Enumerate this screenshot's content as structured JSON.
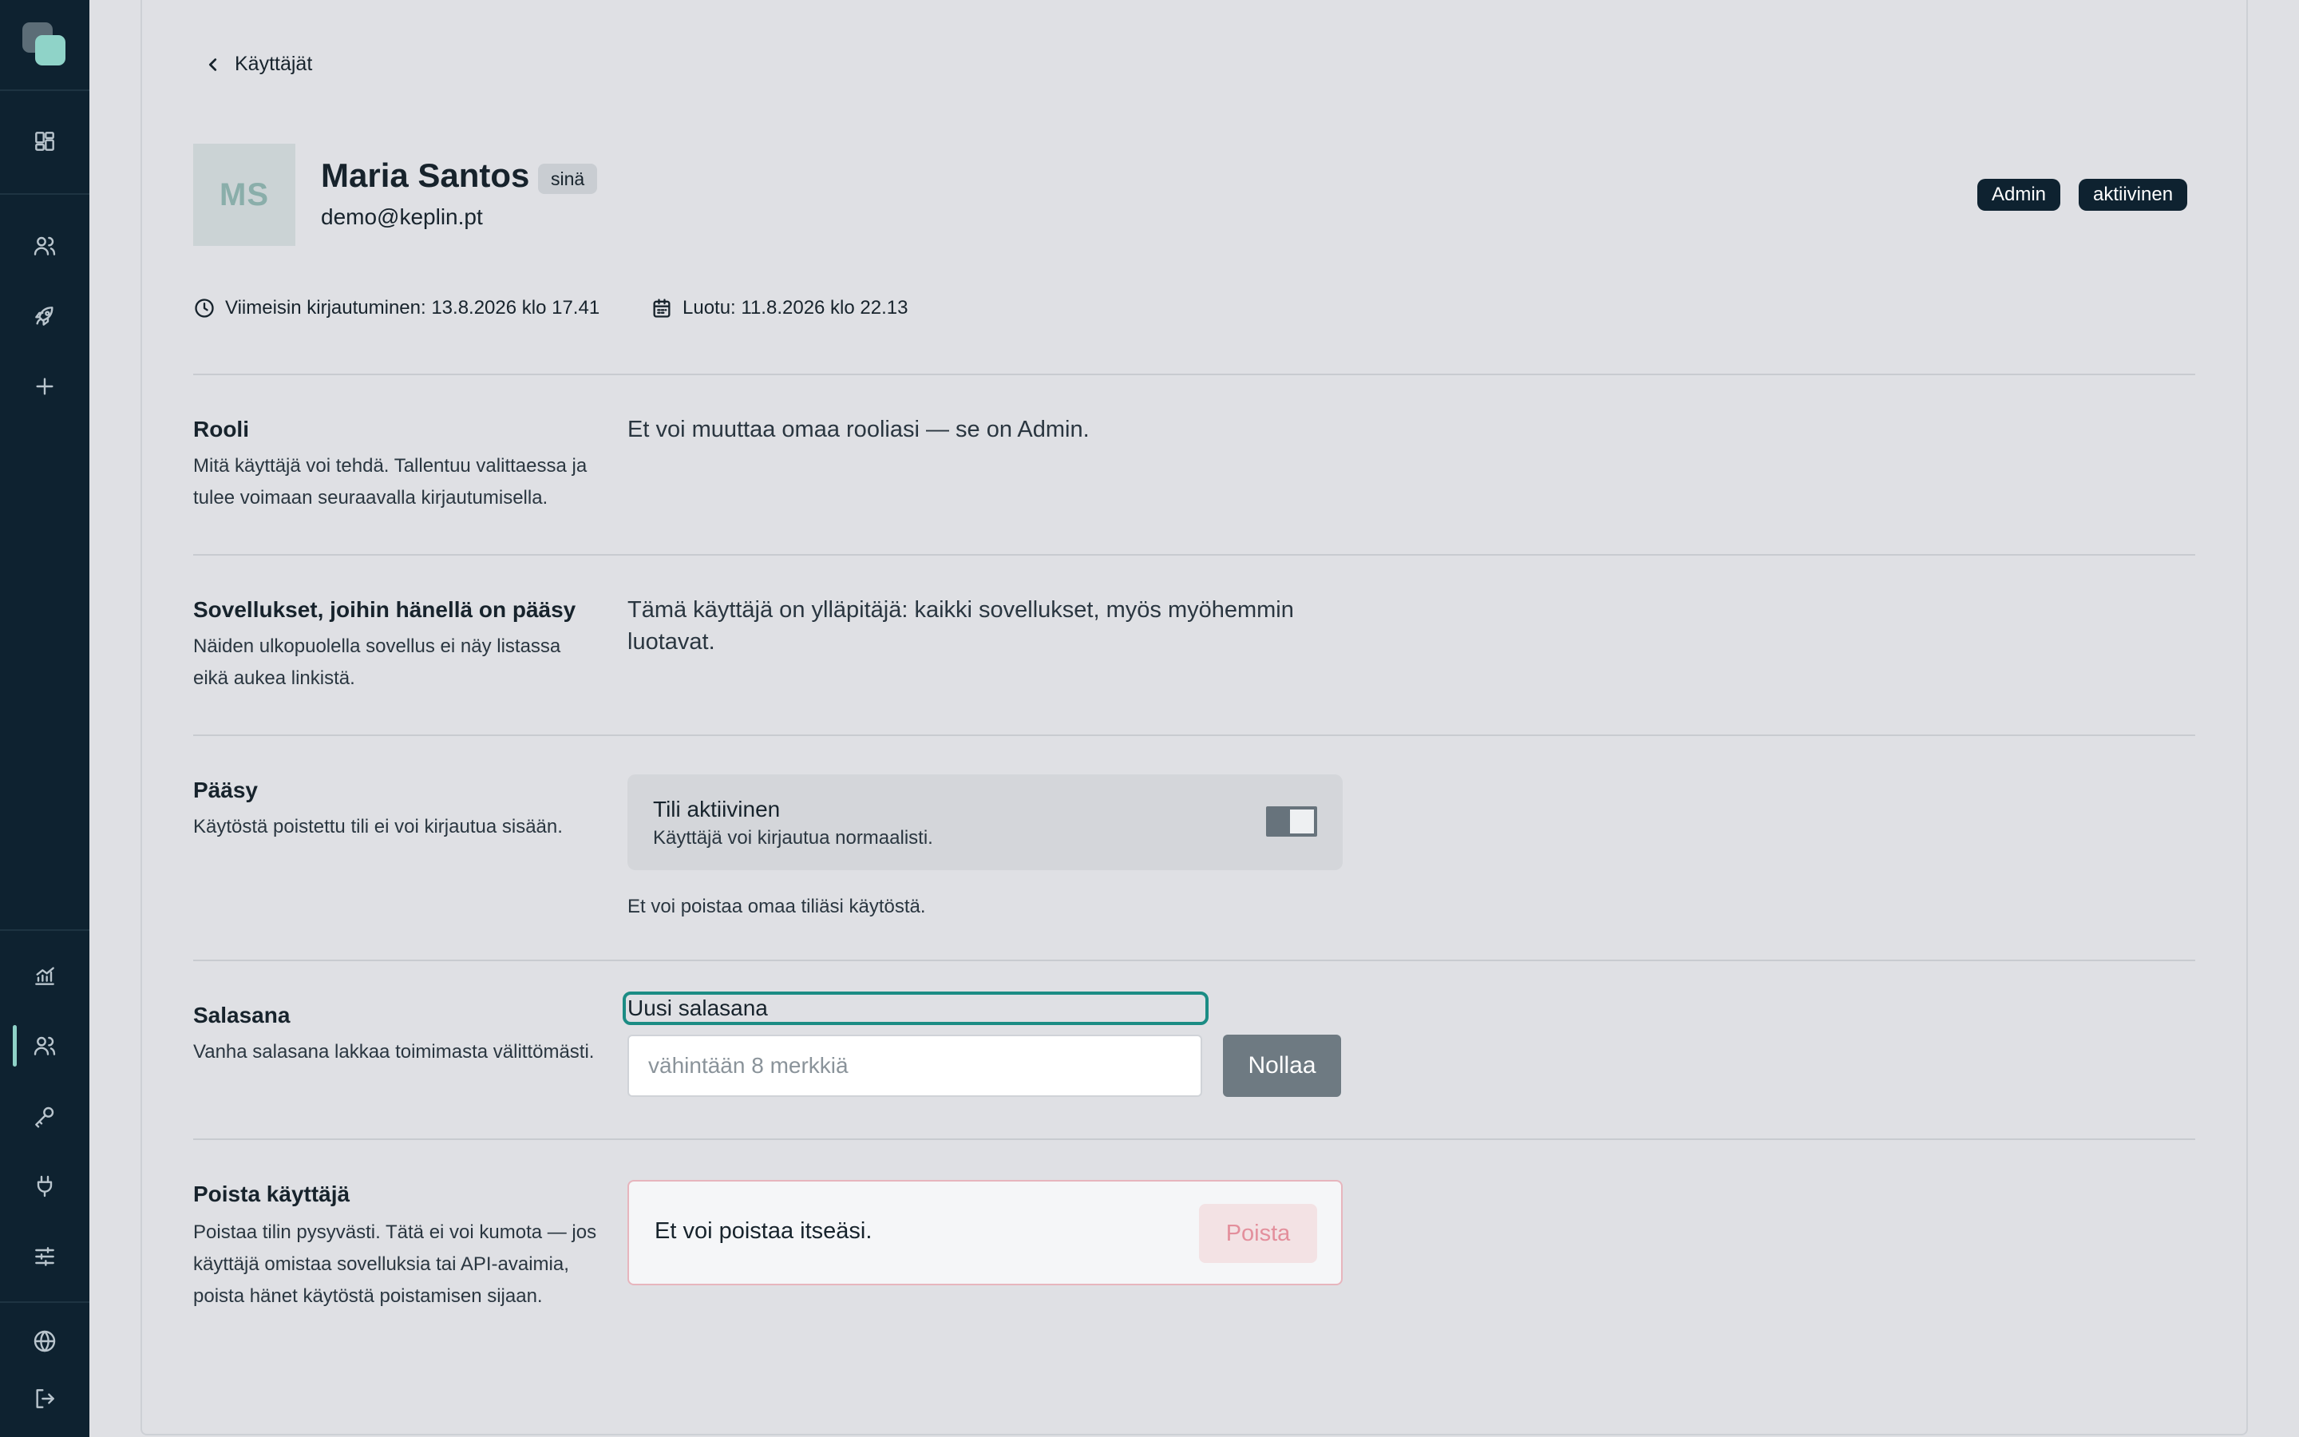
{
  "back_link": {
    "label": "Käyttäjät"
  },
  "user": {
    "initials": "MS",
    "name": "Maria Santos",
    "you_badge": "sinä",
    "email": "demo@keplin.pt",
    "role_badge": "Admin",
    "status_badge": "aktiivinen",
    "last_login": "Viimeisin kirjautuminen: 13.8.2026 klo 17.41",
    "created": "Luotu: 11.8.2026 klo 22.13"
  },
  "sections": {
    "role": {
      "title": "Rooli",
      "desc": "Mitä käyttäjä voi tehdä. Tallentuu valittaessa ja tulee voimaan seuraavalla kirjautumisella.",
      "value": "Et voi muuttaa omaa rooliasi — se on Admin."
    },
    "apps": {
      "title": "Sovellukset, joihin hänellä on pääsy",
      "desc": "Näiden ulkopuolella sovellus ei näy listassa eikä aukea linkistä.",
      "value": "Tämä käyttäjä on ylläpitäjä: kaikki sovellukset, myös myöhemmin luotavat."
    },
    "access": {
      "title": "Pääsy",
      "desc": "Käytöstä poistettu tili ei voi kirjautua sisään.",
      "toggle_title": "Tili aktiivinen",
      "toggle_sub": "Käyttäjä voi kirjautua normaalisti.",
      "toggle_on": true,
      "note": "Et voi poistaa omaa tiliäsi käytöstä."
    },
    "password": {
      "title": "Salasana",
      "desc": "Vanha salasana lakkaa toimimasta välittömästi.",
      "field_label": "Uusi salasana",
      "placeholder": "vähintään 8 merkkiä",
      "value": "",
      "reset_label": "Nollaa"
    },
    "delete": {
      "title": "Poista käyttäjä",
      "desc": "Poistaa tilin pysyvästi. Tätä ei voi kumota — jos käyttäjä omistaa sovelluksia tai API-avaimia, poista hänet käytöstä poistamisen sijaan.",
      "card_text": "Et voi poistaa itseäsi.",
      "delete_label": "Poista"
    }
  },
  "sidebar": {
    "icons": [
      "dashboard-icon",
      "users-icon",
      "rocket-icon",
      "plus-icon",
      "analytics-icon",
      "users-icon",
      "key-icon",
      "plug-icon",
      "sliders-icon",
      "globe-icon",
      "logout-icon"
    ],
    "active": "users-icon"
  },
  "colors": {
    "sidebar_bg": "#0e2230",
    "accent": "#8fd3c8",
    "focus_ring": "#1b8c84",
    "danger_border": "#e7b5bd",
    "danger_text": "#e38f9c"
  }
}
